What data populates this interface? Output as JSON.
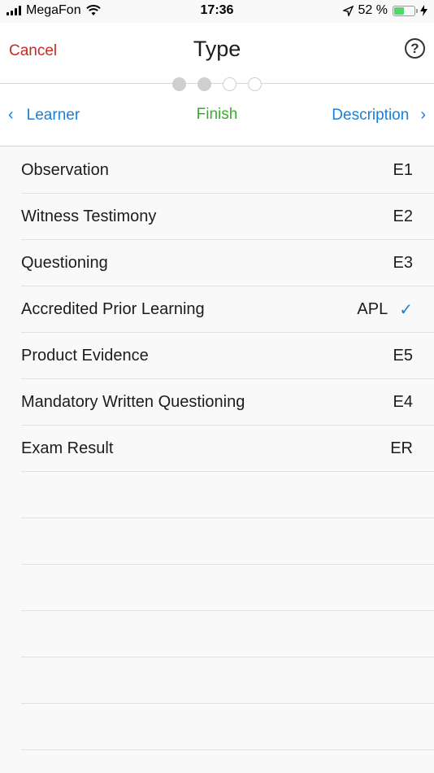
{
  "status_bar": {
    "carrier": "MegaFon",
    "time": "17:36",
    "battery_percent": "52 %",
    "battery_level": 0.52
  },
  "nav": {
    "cancel_label": "Cancel",
    "title": "Type",
    "help_label": "?"
  },
  "steps": {
    "total": 4,
    "completed": 2,
    "prev_label": "Learner",
    "finish_label": "Finish",
    "next_label": "Description",
    "prev_icon": "chevron-left-icon",
    "next_icon": "chevron-right-icon"
  },
  "types": [
    {
      "label": "Observation",
      "code": "E1",
      "selected": false
    },
    {
      "label": "Witness Testimony",
      "code": "E2",
      "selected": false
    },
    {
      "label": "Questioning",
      "code": "E3",
      "selected": false
    },
    {
      "label": "Accredited Prior Learning",
      "code": "APL",
      "selected": true
    },
    {
      "label": "Product Evidence",
      "code": "E5",
      "selected": false
    },
    {
      "label": "Mandatory Written Questioning",
      "code": "E4",
      "selected": false
    },
    {
      "label": "Exam Result",
      "code": "ER",
      "selected": false
    }
  ],
  "colors": {
    "cancel": "#c62a22",
    "link": "#1a7fd8",
    "finish": "#3aad2c",
    "battery": "#4cd964"
  }
}
